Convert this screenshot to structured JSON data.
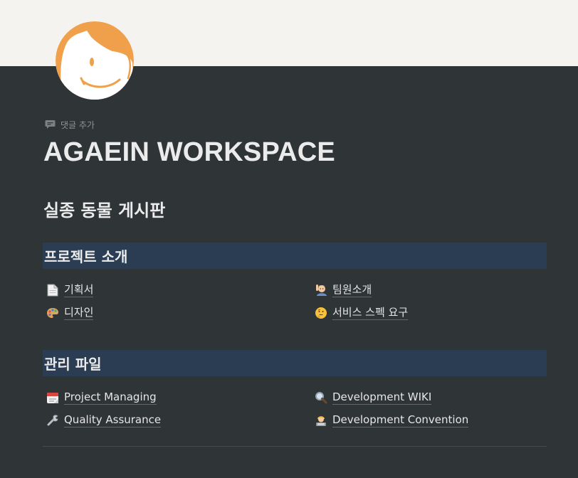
{
  "page": {
    "add_comment": "댓글 추가",
    "title": "AGAEIN WORKSPACE",
    "subtitle": "실종 동물 게시판"
  },
  "sections": [
    {
      "heading": "프로젝트 소개",
      "links": [
        {
          "icon": "page-icon",
          "label": "기획서"
        },
        {
          "icon": "person-raising-hand-icon",
          "label": "팀원소개"
        },
        {
          "icon": "palette-icon",
          "label": "디자인"
        },
        {
          "icon": "thinking-face-icon",
          "label": "서비스 스펙 요구"
        }
      ]
    },
    {
      "heading": "관리 파일",
      "links": [
        {
          "icon": "calendar-icon",
          "label": "Project Managing"
        },
        {
          "icon": "magnifier-icon",
          "label": "Development WIKI"
        },
        {
          "icon": "wrench-icon",
          "label": "Quality Assurance"
        },
        {
          "icon": "technologist-icon",
          "label": "Development Convention"
        }
      ]
    }
  ],
  "colors": {
    "background": "#2f3437",
    "cover": "#f4f3ef",
    "heading_background": "#2b3d52",
    "logo_orange": "#f0a04a"
  }
}
